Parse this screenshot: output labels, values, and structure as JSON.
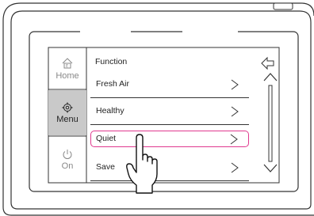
{
  "sidebar": {
    "items": [
      {
        "label": "Home",
        "icon": "home-icon"
      },
      {
        "label": "Menu",
        "icon": "gear-icon",
        "selected": true
      },
      {
        "label": "On",
        "icon": "power-icon"
      }
    ]
  },
  "main": {
    "title": "Function",
    "items": [
      {
        "label": "Fresh Air"
      },
      {
        "label": "Healthy"
      },
      {
        "label": "Quiet",
        "highlighted": true
      },
      {
        "label": "Save"
      }
    ]
  },
  "colors": {
    "highlight": "#e0398f",
    "selected_bg": "#c9c9c9"
  },
  "icons": {
    "back": "back-arrow-icon",
    "scroll_up": "chevron-up-icon",
    "scroll_down": "chevron-down-icon",
    "pointer": "hand-pointer-icon"
  }
}
